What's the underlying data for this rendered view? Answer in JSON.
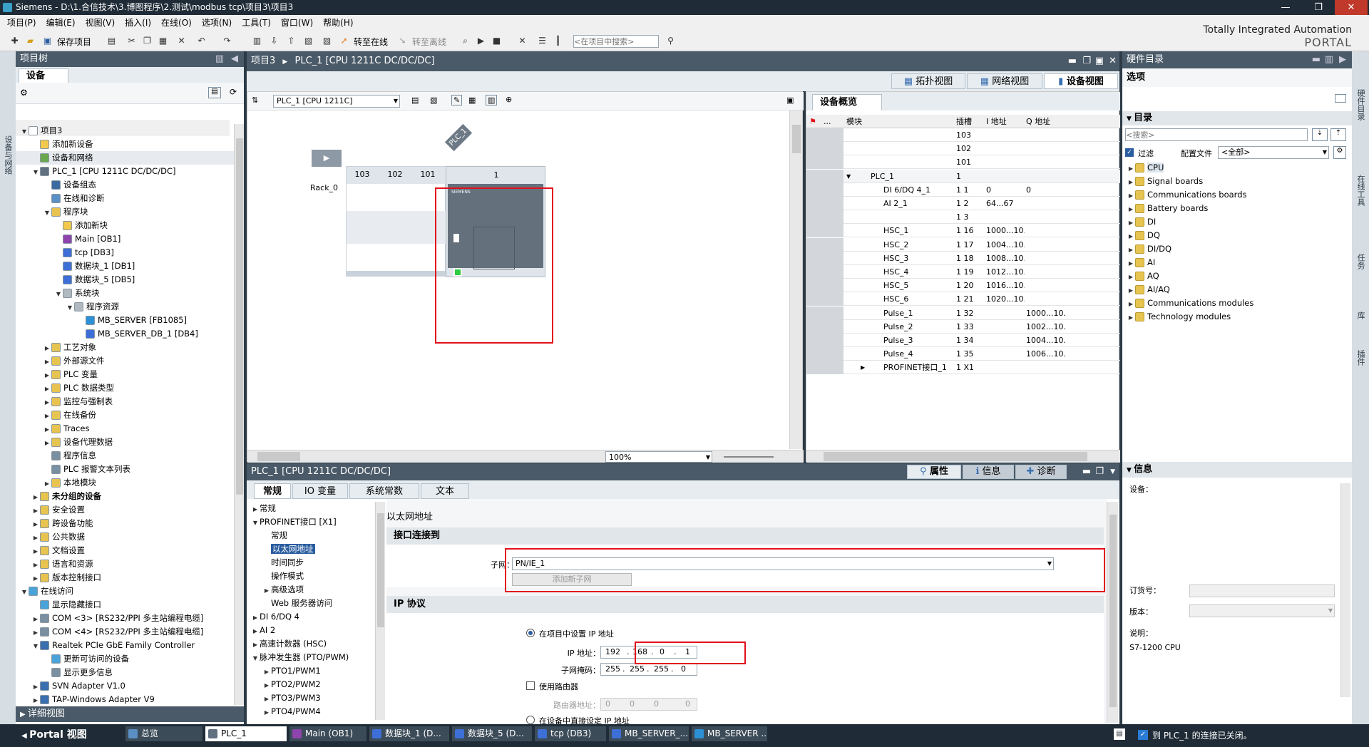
{
  "window": {
    "title": "Siemens  -  D:\\1.合信技术\\3.博图程序\\2.测试\\modbus tcp\\项目3\\项目3",
    "controls": [
      "—",
      "❐",
      "✕"
    ]
  },
  "menu": [
    "项目(P)",
    "编辑(E)",
    "视图(V)",
    "插入(I)",
    "在线(O)",
    "选项(N)",
    "工具(T)",
    "窗口(W)",
    "帮助(H)"
  ],
  "toolbar": {
    "save_label": "保存项目",
    "go_online": "转至在线",
    "go_offline": "转至离线",
    "search_placeholder": "<在项目中搜索>"
  },
  "brand": {
    "line1": "Totally Integrated Automation",
    "line2": "PORTAL"
  },
  "project_tree": {
    "title": "项目树",
    "tab": "设备",
    "side_label": "设备与网络",
    "rows": [
      {
        "label": "项目3",
        "indent": 0,
        "tri": "▼",
        "color": "#ffffff"
      },
      {
        "label": "添加新设备",
        "indent": 1,
        "tri": "",
        "color": "#f2c94c"
      },
      {
        "label": "设备和网络",
        "indent": 1,
        "tri": "",
        "color": "#6aa84f"
      },
      {
        "label": "PLC_1 [CPU 1211C DC/DC/DC]",
        "indent": 1,
        "tri": "▼",
        "color": "#607080"
      },
      {
        "label": "设备组态",
        "indent": 2,
        "tri": "",
        "color": "#3b6aa0"
      },
      {
        "label": "在线和诊断",
        "indent": 2,
        "tri": "",
        "color": "#5a8fc4"
      },
      {
        "label": "程序块",
        "indent": 2,
        "tri": "▼",
        "color": "#e7c350"
      },
      {
        "label": "添加新块",
        "indent": 3,
        "tri": "",
        "color": "#f2c94c"
      },
      {
        "label": "Main [OB1]",
        "indent": 3,
        "tri": "",
        "color": "#8e44ad"
      },
      {
        "label": "tcp [DB3]",
        "indent": 3,
        "tri": "",
        "color": "#3d6fd6"
      },
      {
        "label": "数据块_1 [DB1]",
        "indent": 3,
        "tri": "",
        "color": "#3d6fd6"
      },
      {
        "label": "数据块_5 [DB5]",
        "indent": 3,
        "tri": "",
        "color": "#3d6fd6"
      },
      {
        "label": "系统块",
        "indent": 3,
        "tri": "▼",
        "color": "#b0b8c0"
      },
      {
        "label": "程序资源",
        "indent": 4,
        "tri": "▼",
        "color": "#b0b8c0"
      },
      {
        "label": "MB_SERVER [FB1085]",
        "indent": 5,
        "tri": "",
        "color": "#2d8fd5"
      },
      {
        "label": "MB_SERVER_DB_1 [DB4]",
        "indent": 5,
        "tri": "",
        "color": "#3d6fd6"
      },
      {
        "label": "工艺对象",
        "indent": 2,
        "tri": "▶",
        "color": "#e7c350"
      },
      {
        "label": "外部源文件",
        "indent": 2,
        "tri": "▶",
        "color": "#e7c350"
      },
      {
        "label": "PLC 变量",
        "indent": 2,
        "tri": "▶",
        "color": "#e7c350"
      },
      {
        "label": "PLC 数据类型",
        "indent": 2,
        "tri": "▶",
        "color": "#e7c350"
      },
      {
        "label": "监控与强制表",
        "indent": 2,
        "tri": "▶",
        "color": "#e7c350"
      },
      {
        "label": "在线备份",
        "indent": 2,
        "tri": "▶",
        "color": "#e7c350"
      },
      {
        "label": "Traces",
        "indent": 2,
        "tri": "▶",
        "color": "#e7c350"
      },
      {
        "label": "设备代理数据",
        "indent": 2,
        "tri": "▶",
        "color": "#e7c350"
      },
      {
        "label": "程序信息",
        "indent": 2,
        "tri": "",
        "color": "#7a8fa0"
      },
      {
        "label": "PLC 报警文本列表",
        "indent": 2,
        "tri": "",
        "color": "#7a8fa0"
      },
      {
        "label": "本地模块",
        "indent": 2,
        "tri": "▶",
        "color": "#e7c350"
      },
      {
        "label": "未分组的设备",
        "indent": 1,
        "tri": "▶",
        "color": "#e7c350",
        "bold": true
      },
      {
        "label": "安全设置",
        "indent": 1,
        "tri": "▶",
        "color": "#e7c350"
      },
      {
        "label": "跨设备功能",
        "indent": 1,
        "tri": "▶",
        "color": "#e7c350"
      },
      {
        "label": "公共数据",
        "indent": 1,
        "tri": "▶",
        "color": "#e7c350"
      },
      {
        "label": "文档设置",
        "indent": 1,
        "tri": "▶",
        "color": "#e7c350"
      },
      {
        "label": "语言和资源",
        "indent": 1,
        "tri": "▶",
        "color": "#e7c350"
      },
      {
        "label": "版本控制接口",
        "indent": 1,
        "tri": "▶",
        "color": "#e7c350"
      },
      {
        "label": "在线访问",
        "indent": 0,
        "tri": "▼",
        "color": "#4aa3d8"
      },
      {
        "label": "显示隐藏接口",
        "indent": 1,
        "tri": "",
        "color": "#4aa3d8"
      },
      {
        "label": "COM <3> [RS232/PPI 多主站编程电缆]",
        "indent": 1,
        "tri": "▶",
        "color": "#7a8fa0"
      },
      {
        "label": "COM <4> [RS232/PPI 多主站编程电缆]",
        "indent": 1,
        "tri": "▶",
        "color": "#7a8fa0"
      },
      {
        "label": "Realtek PCIe GbE Family Controller",
        "indent": 1,
        "tri": "▼",
        "color": "#3a6fb0"
      },
      {
        "label": "更新可访问的设备",
        "indent": 2,
        "tri": "",
        "color": "#4aa3d8"
      },
      {
        "label": "显示更多信息",
        "indent": 2,
        "tri": "",
        "color": "#7a8fa0"
      },
      {
        "label": "SVN Adapter V1.0",
        "indent": 1,
        "tri": "▶",
        "color": "#3a6fb0"
      },
      {
        "label": "TAP-Windows Adapter V9",
        "indent": 1,
        "tri": "▶",
        "color": "#3a6fb0"
      }
    ],
    "detail_view": "详细视图"
  },
  "editor": {
    "breadcrumb": [
      "项目3",
      "PLC_1 [CPU 1211C DC/DC/DC]"
    ],
    "views": [
      "拓扑视图",
      "网络视图",
      "设备视图"
    ],
    "device_select": "PLC_1 [CPU 1211C]",
    "zoom": "100%",
    "plc_tag": "PLC_1",
    "rack_label": "Rack_0",
    "slots": [
      "103",
      "102",
      "101",
      "1"
    ],
    "cpu_brand": "SIEMENS",
    "cpu_model": "CPU 1211C DC/DC/DC"
  },
  "device_overview": {
    "title": "设备概览",
    "columns": [
      "",
      "...",
      "模块",
      "插槽",
      "I 地址",
      "Q 地址"
    ],
    "rows": [
      {
        "module": "",
        "slot": "103",
        "i": "",
        "q": "",
        "indent": 0
      },
      {
        "module": "",
        "slot": "102",
        "i": "",
        "q": "",
        "indent": 0
      },
      {
        "module": "",
        "slot": "101",
        "i": "",
        "q": "",
        "indent": 0
      },
      {
        "module": "PLC_1",
        "slot": "1",
        "i": "",
        "q": "",
        "indent": 1,
        "tri": "▼"
      },
      {
        "module": "DI 6/DQ 4_1",
        "slot": "1 1",
        "i": "0",
        "q": "0",
        "indent": 2
      },
      {
        "module": "AI 2_1",
        "slot": "1 2",
        "i": "64...67",
        "q": "",
        "indent": 2
      },
      {
        "module": "",
        "slot": "1 3",
        "i": "",
        "q": "",
        "indent": 2
      },
      {
        "module": "HSC_1",
        "slot": "1 16",
        "i": "1000...10...",
        "q": "",
        "indent": 2
      },
      {
        "module": "HSC_2",
        "slot": "1 17",
        "i": "1004...10...",
        "q": "",
        "indent": 2
      },
      {
        "module": "HSC_3",
        "slot": "1 18",
        "i": "1008...10...",
        "q": "",
        "indent": 2
      },
      {
        "module": "HSC_4",
        "slot": "1 19",
        "i": "1012...10...",
        "q": "",
        "indent": 2
      },
      {
        "module": "HSC_5",
        "slot": "1 20",
        "i": "1016...10...",
        "q": "",
        "indent": 2
      },
      {
        "module": "HSC_6",
        "slot": "1 21",
        "i": "1020...10...",
        "q": "",
        "indent": 2
      },
      {
        "module": "Pulse_1",
        "slot": "1 32",
        "i": "",
        "q": "1000...10...",
        "indent": 2
      },
      {
        "module": "Pulse_2",
        "slot": "1 33",
        "i": "",
        "q": "1002...10...",
        "indent": 2
      },
      {
        "module": "Pulse_3",
        "slot": "1 34",
        "i": "",
        "q": "1004...10...",
        "indent": 2
      },
      {
        "module": "Pulse_4",
        "slot": "1 35",
        "i": "",
        "q": "1006...10...",
        "indent": 2
      },
      {
        "module": "PROFINET接口_1",
        "slot": "1 X1",
        "i": "",
        "q": "",
        "indent": 2,
        "tri": "▶"
      }
    ]
  },
  "properties": {
    "header": "PLC_1 [CPU 1211C DC/DC/DC]",
    "right_tabs": [
      "属性",
      "信息",
      "诊断"
    ],
    "tabs": [
      "常规",
      "IO 变量",
      "系统常数",
      "文本"
    ],
    "nav": [
      {
        "label": "常规",
        "indent": 0,
        "tri": "▶"
      },
      {
        "label": "PROFINET接口 [X1]",
        "indent": 0,
        "tri": "▼"
      },
      {
        "label": "常规",
        "indent": 1,
        "tri": ""
      },
      {
        "label": "以太网地址",
        "indent": 1,
        "tri": "",
        "selected": true
      },
      {
        "label": "时间同步",
        "indent": 1,
        "tri": ""
      },
      {
        "label": "操作模式",
        "indent": 1,
        "tri": ""
      },
      {
        "label": "高级选项",
        "indent": 1,
        "tri": "▶"
      },
      {
        "label": "Web 服务器访问",
        "indent": 1,
        "tri": ""
      },
      {
        "label": "DI 6/DQ 4",
        "indent": 0,
        "tri": "▶"
      },
      {
        "label": "AI 2",
        "indent": 0,
        "tri": "▶"
      },
      {
        "label": "高速计数器 (HSC)",
        "indent": 0,
        "tri": "▶"
      },
      {
        "label": "脉冲发生器 (PTO/PWM)",
        "indent": 0,
        "tri": "▼"
      },
      {
        "label": "PTO1/PWM1",
        "indent": 1,
        "tri": "▶"
      },
      {
        "label": "PTO2/PWM2",
        "indent": 1,
        "tri": "▶"
      },
      {
        "label": "PTO3/PWM3",
        "indent": 1,
        "tri": "▶"
      },
      {
        "label": "PTO4/PWM4",
        "indent": 1,
        "tri": "▶"
      }
    ],
    "section_title": "以太网地址",
    "interface_group": "接口连接到",
    "subnet_label": "子网：",
    "subnet_value": "PN/IE_1",
    "add_subnet": "添加新子网",
    "ip_group": "IP 协议",
    "set_in_project": "在项目中设置 IP 地址",
    "ip_label": "IP 地址：",
    "ip": [
      "192",
      "168",
      "0",
      "1"
    ],
    "mask_label": "子网掩码：",
    "mask": [
      "255",
      "255",
      "255",
      "0"
    ],
    "use_router": "使用路由器",
    "router_label": "路由器地址：",
    "router": [
      "0",
      "0",
      "0",
      "0"
    ],
    "direct_set": "在设备中直接设定 IP 地址"
  },
  "catalog": {
    "title": "硬件目录",
    "options": "选项",
    "directory": "目录",
    "search_placeholder": "<搜索>",
    "filter_label": "过滤",
    "profile_label": "配置文件",
    "profile_value": "<全部>",
    "items": [
      "CPU",
      "Signal boards",
      "Communications boards",
      "Battery boards",
      "DI",
      "DQ",
      "DI/DQ",
      "AI",
      "AQ",
      "AI/AQ",
      "Communications modules",
      "Technology modules"
    ],
    "side_tabs": [
      "硬件目录",
      "在线工具",
      "任务",
      "库",
      "插件"
    ]
  },
  "info_panel": {
    "title": "信息",
    "device_label": "设备：",
    "order_label": "订货号：",
    "version_label": "版本：",
    "desc_label": "说明：",
    "desc_value": "S7-1200 CPU"
  },
  "taskbar": {
    "portal_view": "Portal 视图",
    "items": [
      {
        "label": "总览",
        "color": "#5a8fc4"
      },
      {
        "label": "PLC_1",
        "color": "#607080",
        "active": true
      },
      {
        "label": "Main (OB1)",
        "color": "#8e44ad"
      },
      {
        "label": "数据块_1 (D...",
        "color": "#3d6fd6"
      },
      {
        "label": "数据块_5 (D...",
        "color": "#3d6fd6"
      },
      {
        "label": "tcp (DB3)",
        "color": "#3d6fd6"
      },
      {
        "label": "MB_SERVER_...",
        "color": "#3d6fd6"
      },
      {
        "label": "MB_SERVER ...",
        "color": "#2d8fd5"
      }
    ],
    "status": "到 PLC_1 的连接已关闭。"
  }
}
